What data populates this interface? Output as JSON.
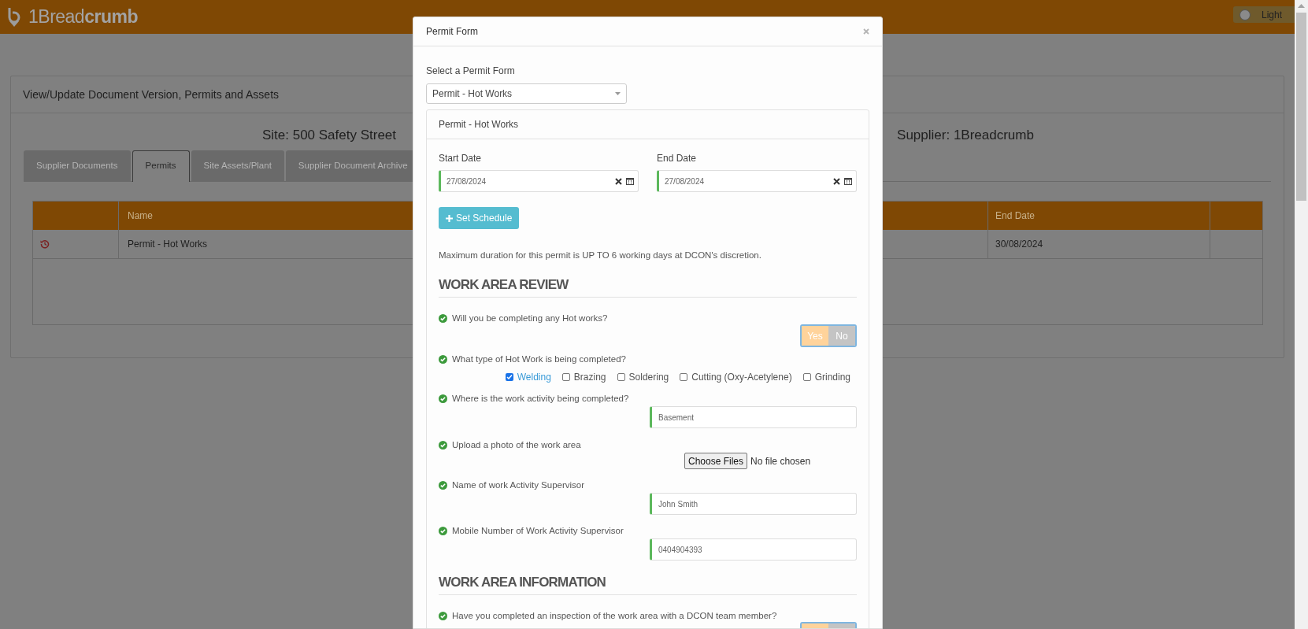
{
  "header": {
    "logo": "1Bread**crumb**",
    "theme_toggle": {
      "label": "Light",
      "on": false
    }
  },
  "page": {
    "card_title": "View/Update Document Version, Permits and Assets",
    "site": "Site: 500 Safety Street",
    "supplier": "Supplier: 1Breadcrumb",
    "tabs": [
      {
        "label": "Supplier Documents",
        "selected": false
      },
      {
        "label": "Permits",
        "selected": true
      },
      {
        "label": "Site Assets/Plant",
        "selected": false
      },
      {
        "label": "Supplier Document Archive",
        "selected": false
      }
    ],
    "table": {
      "columns": {
        "name": "Name",
        "end_date": "End Date"
      },
      "rows": [
        {
          "name": "Permit - Hot Works",
          "end_date": "30/08/2024"
        }
      ]
    }
  },
  "modal": {
    "title": "Permit Form",
    "select_label": "Select a Permit Form",
    "select_value": "Permit - Hot Works",
    "panel_title": "Permit - Hot Works",
    "start_date": {
      "label": "Start Date",
      "value": "27/08/2024"
    },
    "end_date": {
      "label": "End Date",
      "value": "27/08/2024"
    },
    "schedule_button": "Set Schedule",
    "note": "Maximum duration for this permit is UP TO 6 working days at DCON's discretion.",
    "sections": [
      {
        "heading": "WORK AREA REVIEW",
        "questions": [
          {
            "kind": "yesno",
            "text": "Will you be completing any Hot works?",
            "options": [
              {
                "label": "Yes",
                "selected": true
              },
              {
                "label": "No",
                "selected": false
              }
            ]
          },
          {
            "kind": "checkboxes",
            "text": "What type of Hot Work is being completed?",
            "options": [
              {
                "label": "Welding",
                "checked": true
              },
              {
                "label": "Brazing",
                "checked": false
              },
              {
                "label": "Soldering",
                "checked": false
              },
              {
                "label": "Cutting (Oxy-Acetylene)",
                "checked": false
              },
              {
                "label": "Grinding",
                "checked": false
              }
            ]
          },
          {
            "kind": "text",
            "text": "Where is the work activity being completed?",
            "value": "Basement"
          },
          {
            "kind": "file",
            "text": "Upload a photo of the work area",
            "button": "Choose Files",
            "status": "No file chosen"
          },
          {
            "kind": "text",
            "text": "Name of work Activity Supervisor",
            "value": "John Smith"
          },
          {
            "kind": "text",
            "text": "Mobile Number of Work Activity Supervisor",
            "value": "0404904393"
          }
        ]
      },
      {
        "heading": "WORK AREA INFORMATION",
        "questions": [
          {
            "kind": "yesno",
            "text": "Have you completed an inspection of the work area with a DCON team member?",
            "options": [
              {
                "selected": true
              },
              {
                "selected": false
              }
            ]
          }
        ]
      }
    ]
  }
}
